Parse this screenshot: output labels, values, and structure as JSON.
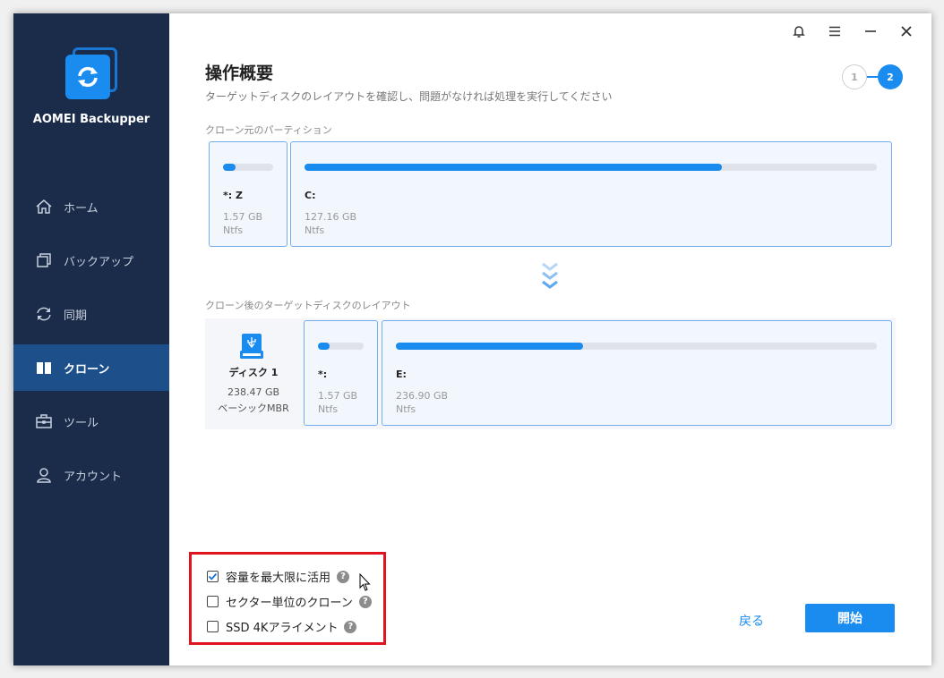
{
  "app": {
    "name": "AOMEI Backupper"
  },
  "sidebar": {
    "items": [
      {
        "label": "ホーム",
        "icon": "home-icon",
        "active": false
      },
      {
        "label": "バックアップ",
        "icon": "backup-icon",
        "active": false
      },
      {
        "label": "同期",
        "icon": "sync-icon",
        "active": false
      },
      {
        "label": "クローン",
        "icon": "clone-icon",
        "active": true
      },
      {
        "label": "ツール",
        "icon": "toolbox-icon",
        "active": false
      },
      {
        "label": "アカウント",
        "icon": "user-icon",
        "active": false
      }
    ]
  },
  "topbar": {
    "icons": [
      "bell-icon",
      "menu-icon",
      "minimize-icon",
      "close-icon"
    ]
  },
  "page": {
    "title": "操作概要",
    "subtitle": "ターゲットディスクのレイアウトを確認し、問題がなければ処理を実行してください",
    "steps": [
      "1",
      "2"
    ],
    "current_step": "2"
  },
  "source": {
    "label": "クローン元のパーティション",
    "partitions": [
      {
        "name": "*: Z",
        "size": "1.57 GB",
        "fs": "Ntfs",
        "used": 0.25
      },
      {
        "name": "C:",
        "size": "127.16 GB",
        "fs": "Ntfs",
        "used": 0.73
      }
    ]
  },
  "target": {
    "label": "クローン後のターゲットディスクのレイアウト",
    "disk": {
      "name": "ディスク 1",
      "size": "238.47 GB",
      "type": "ベーシックMBR"
    },
    "partitions": [
      {
        "name": "*:",
        "size": "1.57 GB",
        "fs": "Ntfs",
        "used": 0.25
      },
      {
        "name": "E:",
        "size": "236.90 GB",
        "fs": "Ntfs",
        "used": 0.39
      }
    ]
  },
  "options": [
    {
      "label": "容量を最大限に活用",
      "checked": true,
      "help": "?"
    },
    {
      "label": "セクター単位のクローン",
      "checked": false,
      "help": "?"
    },
    {
      "label": "SSD 4Kアライメント",
      "checked": false,
      "help": "?"
    }
  ],
  "footer": {
    "back_label": "戻る",
    "start_label": "開始"
  },
  "colors": {
    "accent": "#1a8cf0",
    "sidebar": "#1a2c4a",
    "sidebar_active": "#1d4f8b",
    "highlight_box": "#e0141e"
  }
}
